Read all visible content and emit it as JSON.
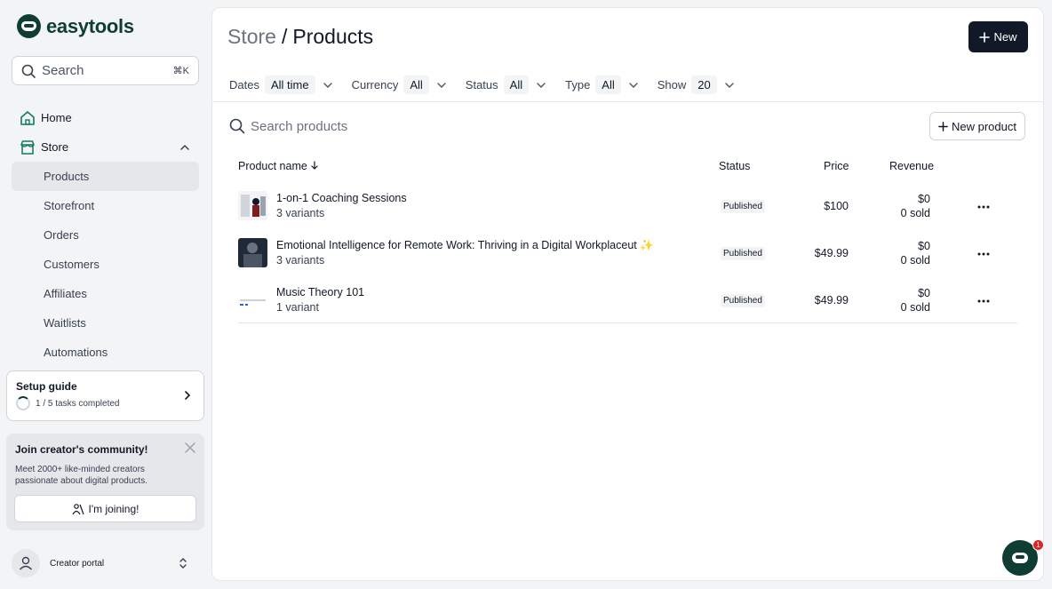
{
  "brand": {
    "name": "easytools"
  },
  "sidebar": {
    "search": {
      "placeholder": "Search",
      "shortcut": "⌘K"
    },
    "nav": [
      {
        "label": "Home",
        "icon": "home-icon"
      },
      {
        "label": "Store",
        "icon": "store-icon",
        "expanded": true
      }
    ],
    "store_items": [
      {
        "label": "Products",
        "active": true
      },
      {
        "label": "Storefront"
      },
      {
        "label": "Orders"
      },
      {
        "label": "Customers"
      },
      {
        "label": "Affiliates"
      },
      {
        "label": "Waitlists"
      },
      {
        "label": "Automations"
      }
    ],
    "setup": {
      "title": "Setup guide",
      "progress_text": "1 / 5 tasks completed",
      "completed": 1,
      "total": 5
    },
    "community": {
      "title": "Join creator's community!",
      "description": "Meet 2000+ like-minded creators passionate about digital products.",
      "button": "I'm joining!"
    },
    "creator_portal": {
      "label": "Creator portal"
    }
  },
  "header": {
    "breadcrumb_parent": "Store",
    "breadcrumb_sep": "/",
    "breadcrumb_current": "Products",
    "new_button": "New"
  },
  "filters": [
    {
      "label": "Dates",
      "value": "All time"
    },
    {
      "label": "Currency",
      "value": "All"
    },
    {
      "label": "Status",
      "value": "All"
    },
    {
      "label": "Type",
      "value": "All"
    },
    {
      "label": "Show",
      "value": "20"
    }
  ],
  "products_search": {
    "placeholder": "Search products",
    "new_product_button": "New product"
  },
  "table": {
    "columns": {
      "name": "Product name",
      "status": "Status",
      "price": "Price",
      "revenue": "Revenue"
    },
    "rows": [
      {
        "name": "1-on-1 Coaching Sessions",
        "variants": "3 variants",
        "status": "Published",
        "price": "$100",
        "revenue": "$0",
        "sold": "0 sold"
      },
      {
        "name": "Emotional Intelligence for Remote Work: Thriving in a Digital Workplaceut ✨",
        "variants": "3 variants",
        "status": "Published",
        "price": "$49.99",
        "revenue": "$0",
        "sold": "0 sold"
      },
      {
        "name": "Music Theory 101",
        "variants": "1 variant",
        "status": "Published",
        "price": "$49.99",
        "revenue": "$0",
        "sold": "0 sold"
      }
    ]
  },
  "chat": {
    "unread": "1"
  },
  "colors": {
    "brand": "#0f3d33",
    "primary_button": "#111827",
    "badge_bg": "#f3f4f6",
    "notification": "#dc2626"
  }
}
